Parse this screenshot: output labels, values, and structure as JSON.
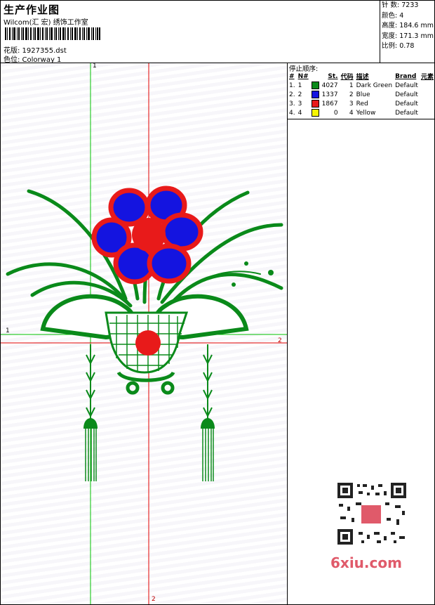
{
  "header": {
    "title": "生产作业图",
    "subtitle": "Wilcom(汇 宏) 绣饰工作室",
    "design_label": "花版: 1927355.dst",
    "colorway_label": "色位: Colorway 1"
  },
  "stats": [
    {
      "label": "针 数",
      "value": "7233"
    },
    {
      "label": "颜色",
      "value": "4"
    },
    {
      "label": "高度",
      "value": "184.6 mm"
    },
    {
      "label": "宽度",
      "value": "171.3 mm"
    },
    {
      "label": "比例",
      "value": "0.78"
    }
  ],
  "stop_sequence": {
    "title": "停止顺序:",
    "columns": [
      "#",
      "N#",
      "St.",
      "代码",
      "描述",
      "Brand",
      "元素"
    ],
    "rows": [
      {
        "index": "1.",
        "n": "1",
        "color": "#0a8a1a",
        "stitches": "4027",
        "code": "1",
        "desc": "Dark Green",
        "brand": "Default"
      },
      {
        "index": "2.",
        "n": "2",
        "color": "#1414e0",
        "stitches": "1337",
        "code": "2",
        "desc": "Blue",
        "brand": "Default"
      },
      {
        "index": "3.",
        "n": "3",
        "color": "#e81a1a",
        "stitches": "1867",
        "code": "3",
        "desc": "Red",
        "brand": "Default"
      },
      {
        "index": "4.",
        "n": "4",
        "color": "#f5f500",
        "stitches": "0",
        "code": "4",
        "desc": "Yellow",
        "brand": "Default"
      }
    ]
  },
  "axes": {
    "green_top": "1",
    "green_left": "1",
    "red_right": "2",
    "red_bottom": "2"
  },
  "watermark": "6xiu.com",
  "colors": {
    "green": "#0a8a1a",
    "blue": "#1414e0",
    "red": "#e81a1a",
    "guide_green": "#00c000",
    "guide_red": "#e00000"
  }
}
